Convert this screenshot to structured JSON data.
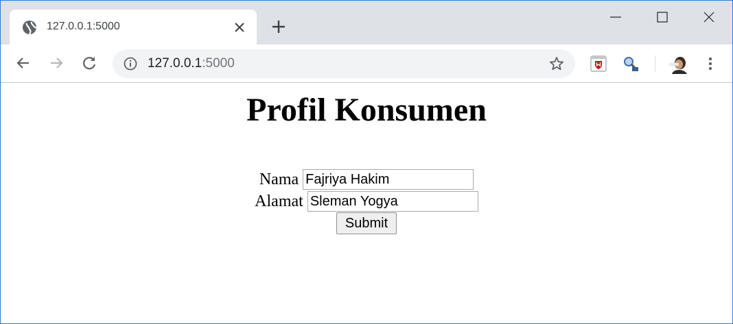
{
  "browser": {
    "tab": {
      "title": "127.0.0.1:5000",
      "favicon": "globe-icon"
    },
    "address": {
      "host": "127.0.0.1",
      "port": ":5000"
    },
    "colors": {
      "tabstrip": "#dee1e6",
      "omnibox": "#f1f3f4",
      "window_border": "#2b7cd3"
    }
  },
  "page": {
    "title": "Profil Konsumen",
    "form": {
      "nama_label": "Nama",
      "nama_value": "Fajriya Hakim",
      "alamat_label": "Alamat",
      "alamat_value": "Sleman Yogya",
      "submit_label": "Submit"
    }
  }
}
